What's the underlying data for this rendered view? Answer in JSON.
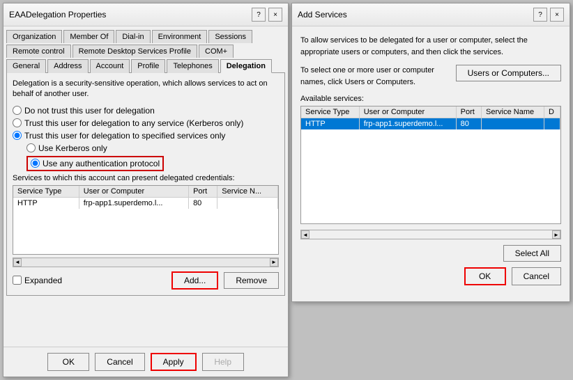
{
  "mainDialog": {
    "title": "EAADelegation Properties",
    "titleBtns": [
      "?",
      "×"
    ],
    "tabs": {
      "row1": [
        {
          "label": "Organization",
          "active": false
        },
        {
          "label": "Member Of",
          "active": false
        },
        {
          "label": "Dial-in",
          "active": false
        },
        {
          "label": "Environment",
          "active": false
        },
        {
          "label": "Sessions",
          "active": false
        }
      ],
      "row2": [
        {
          "label": "Remote control",
          "active": false
        },
        {
          "label": "Remote Desktop Services Profile",
          "active": false
        },
        {
          "label": "COM+",
          "active": false
        }
      ],
      "row3": [
        {
          "label": "General",
          "active": false
        },
        {
          "label": "Address",
          "active": false
        },
        {
          "label": "Account",
          "active": false
        },
        {
          "label": "Profile",
          "active": false
        },
        {
          "label": "Telephones",
          "active": false
        },
        {
          "label": "Delegation",
          "active": true
        }
      ]
    },
    "content": {
      "description": "Delegation is a security-sensitive operation, which allows services to act on behalf of another user.",
      "radios": [
        {
          "id": "r1",
          "label": "Do not trust this user for delegation",
          "checked": false,
          "sub": false
        },
        {
          "id": "r2",
          "label": "Trust this user for delegation to any service (Kerberos only)",
          "checked": false,
          "sub": false
        },
        {
          "id": "r3",
          "label": "Trust this user for delegation to specified services only",
          "checked": true,
          "sub": false
        },
        {
          "id": "r3a",
          "label": "Use Kerberos only",
          "checked": false,
          "sub": true
        },
        {
          "id": "r3b",
          "label": "Use any authentication protocol",
          "checked": true,
          "sub": true,
          "highlighted": true
        }
      ],
      "servicesLabel": "Services to which this account can present delegated credentials:",
      "tableHeaders": [
        "Service Type",
        "User or Computer",
        "Port",
        "Service N..."
      ],
      "tableData": [
        {
          "serviceType": "HTTP",
          "userOrComputer": "frp-app1.superdemo.l...",
          "port": "80",
          "serviceName": ""
        }
      ],
      "expandedLabel": "Expanded",
      "addBtn": "Add...",
      "removeBtn": "Remove"
    },
    "footer": {
      "okBtn": "OK",
      "cancelBtn": "Cancel",
      "applyBtn": "Apply",
      "helpBtn": "Help"
    }
  },
  "addServicesDialog": {
    "title": "Add Services",
    "titleBtns": [
      "?",
      "×"
    ],
    "description": "To allow services to be delegated for a user or computer, select the appropriate users or computers, and then click the services.",
    "selectText": "To select one or more user or computer names, click Users or Computers.",
    "usersComputersBtn": "Users or Computers...",
    "availableLabel": "Available services:",
    "tableHeaders": [
      "Service Type",
      "User or Computer",
      "Port",
      "Service Name",
      "D"
    ],
    "tableData": [
      {
        "serviceType": "HTTP",
        "userOrComputer": "frp-app1.superdemo.l...",
        "port": "80",
        "serviceName": "",
        "d": "",
        "selected": true
      }
    ],
    "selectAllBtn": "Select All",
    "footer": {
      "okBtn": "OK",
      "cancelBtn": "Cancel"
    }
  }
}
